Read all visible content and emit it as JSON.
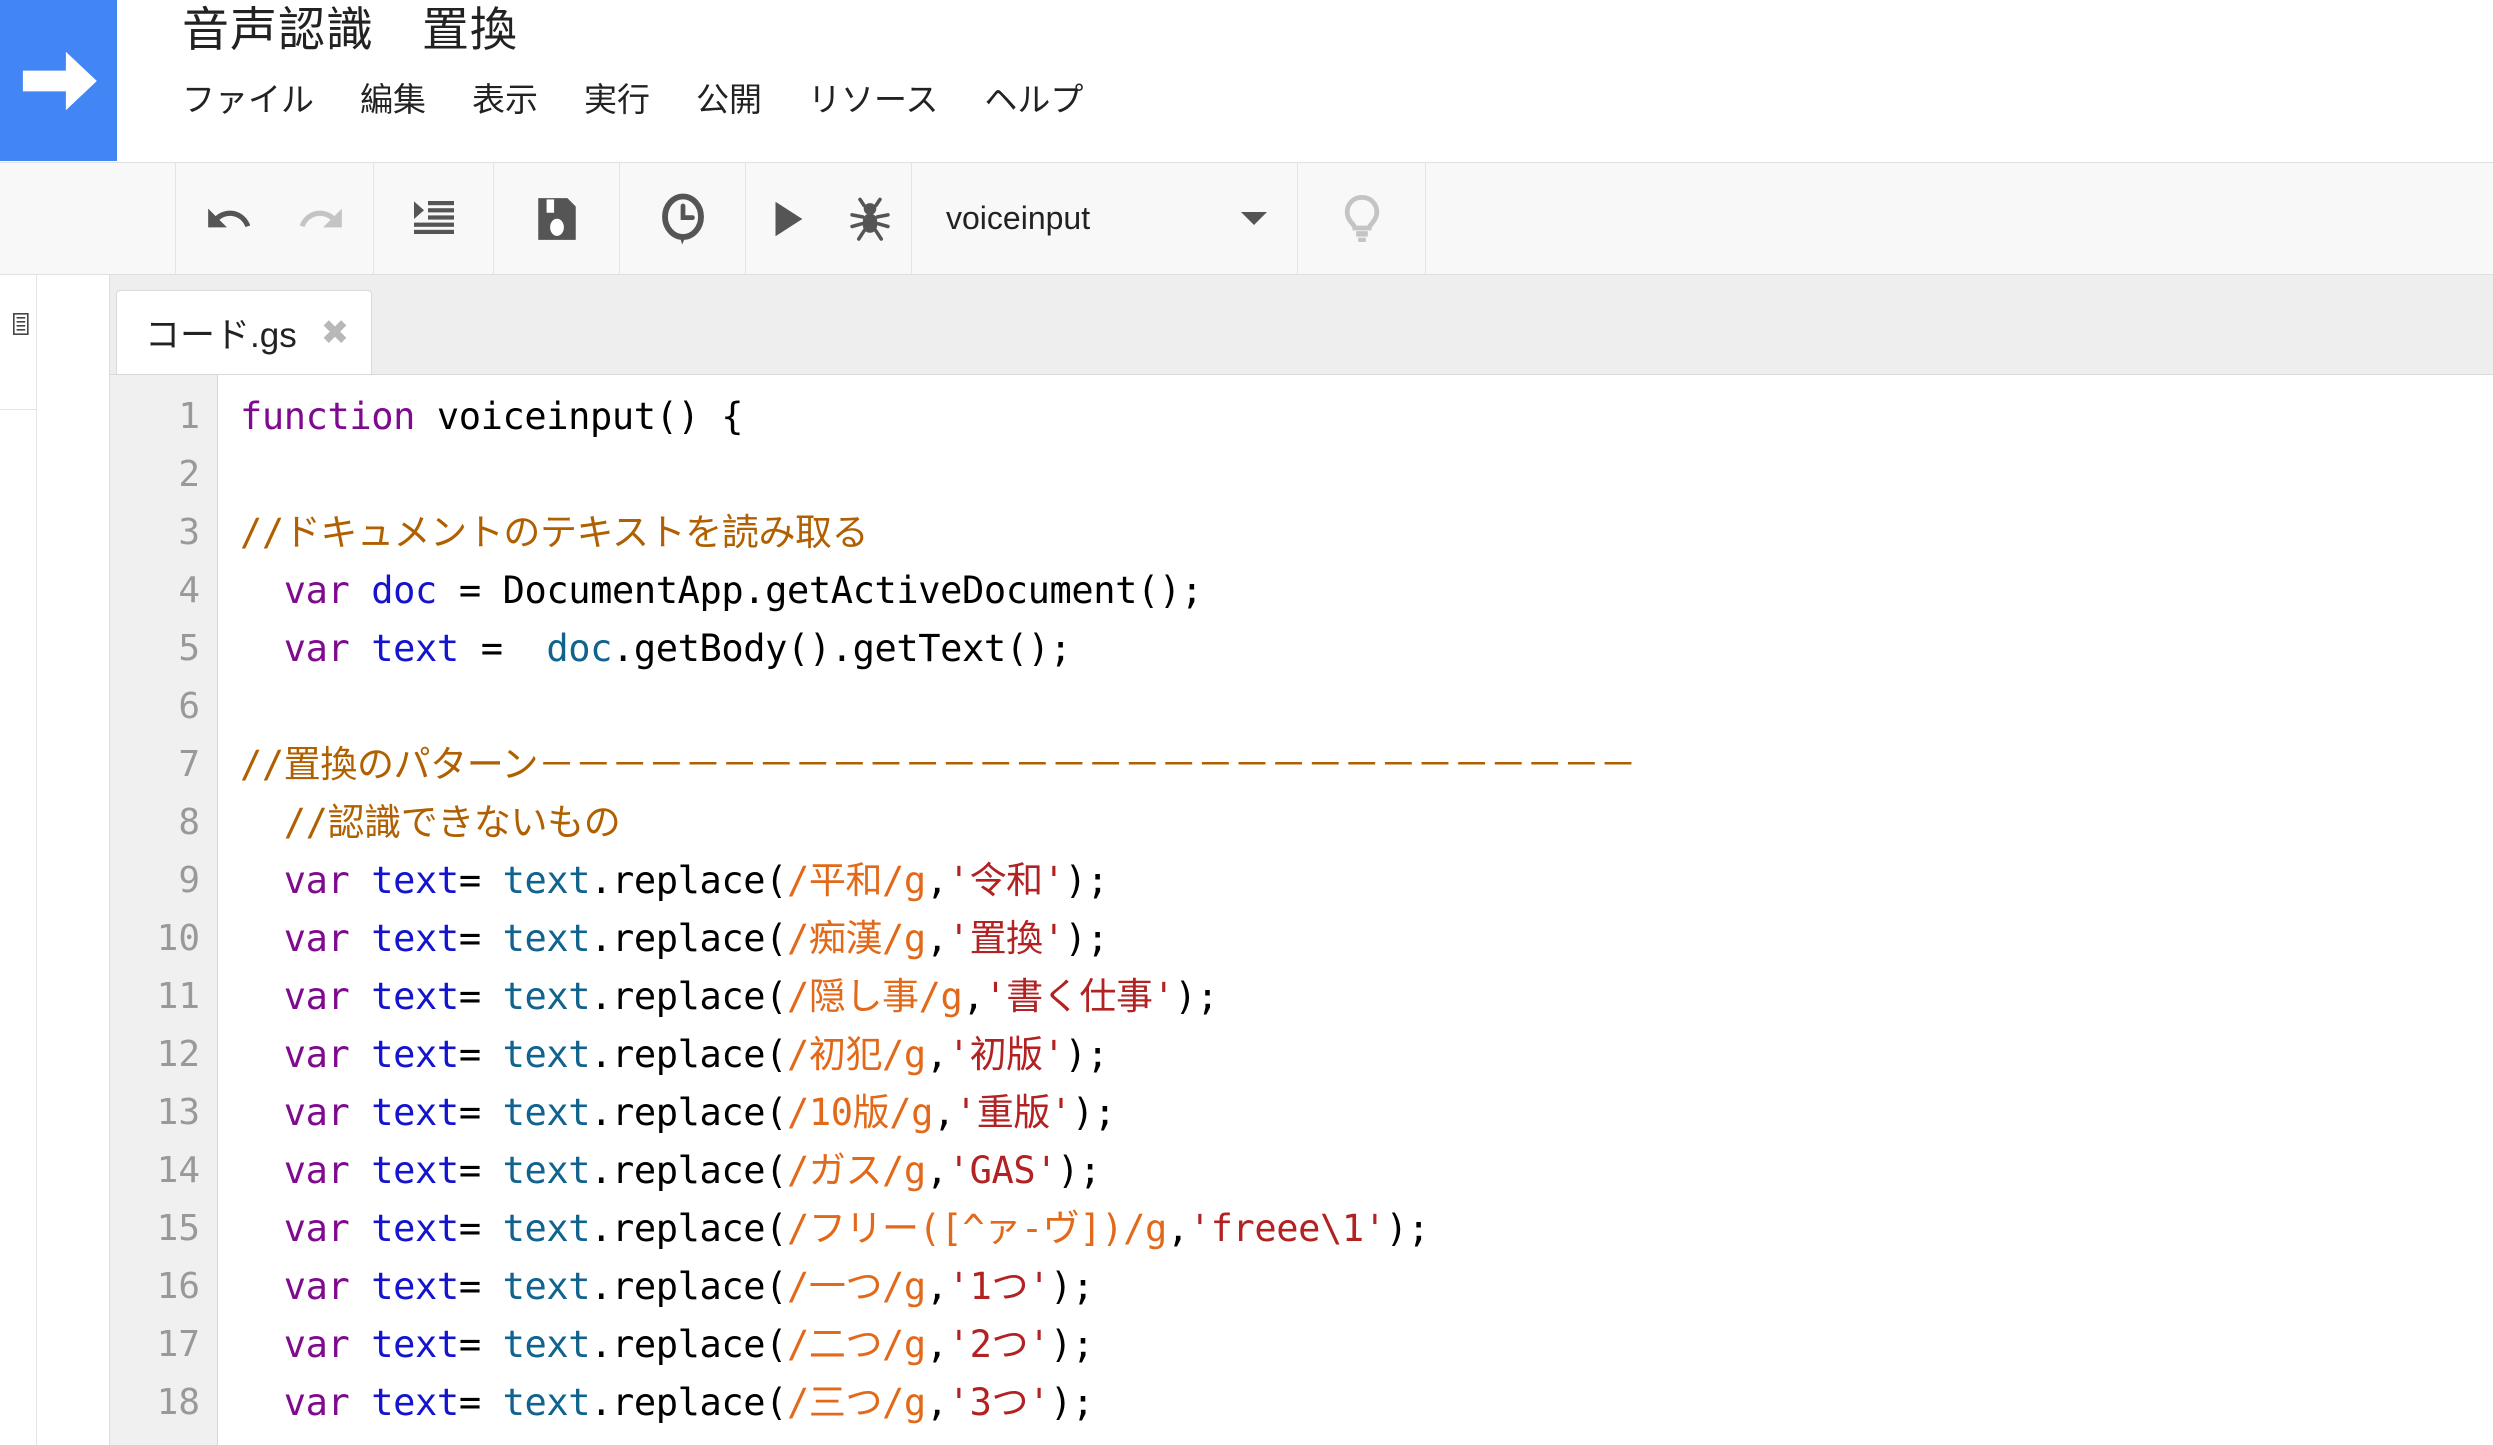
{
  "header": {
    "logo_icon": "arrow-right-icon",
    "doc_title": "音声認識　置換",
    "menu": [
      {
        "label": "ファイル",
        "name": "menu-file"
      },
      {
        "label": "編集",
        "name": "menu-edit"
      },
      {
        "label": "表示",
        "name": "menu-view"
      },
      {
        "label": "実行",
        "name": "menu-run"
      },
      {
        "label": "公開",
        "name": "menu-publish"
      },
      {
        "label": "リソース",
        "name": "menu-resources"
      },
      {
        "label": "ヘルプ",
        "name": "menu-help"
      }
    ]
  },
  "toolbar": {
    "undo_icon": "undo-icon",
    "redo_icon": "redo-icon",
    "indent_icon": "indent-icon",
    "save_icon": "save-icon",
    "history_icon": "clock-history-icon",
    "run_icon": "run-play-icon",
    "debug_icon": "debug-bug-icon",
    "hint_icon": "lightbulb-icon",
    "function_select": {
      "value": "voiceinput",
      "caret_icon": "chevron-down-icon"
    }
  },
  "sidebar": {
    "list_icon": "file-list-icon"
  },
  "editor": {
    "tab": {
      "label": "コード.gs",
      "close_icon": "close-icon",
      "close_glyph": "✖"
    },
    "line_numbers": [
      "1",
      "2",
      "3",
      "4",
      "5",
      "6",
      "7",
      "8",
      "9",
      "10",
      "11",
      "12",
      "13",
      "14",
      "15",
      "16",
      "17",
      "18"
    ],
    "lines": [
      {
        "n": "1",
        "tokens": [
          {
            "t": "function ",
            "c": "kw"
          },
          {
            "t": "voiceinput() {",
            "c": "plain"
          }
        ]
      },
      {
        "n": "2",
        "tokens": [
          {
            "t": "",
            "c": "plain"
          }
        ]
      },
      {
        "n": "3",
        "tokens": [
          {
            "t": "//ドキュメントのテキストを読み取る",
            "c": "comment"
          }
        ]
      },
      {
        "n": "4",
        "tokens": [
          {
            "t": "  ",
            "c": "plain"
          },
          {
            "t": "var",
            "c": "kw"
          },
          {
            "t": " ",
            "c": "plain"
          },
          {
            "t": "doc",
            "c": "var"
          },
          {
            "t": " = DocumentApp.getActiveDocument();",
            "c": "plain"
          }
        ]
      },
      {
        "n": "5",
        "tokens": [
          {
            "t": "  ",
            "c": "plain"
          },
          {
            "t": "var",
            "c": "kw"
          },
          {
            "t": " ",
            "c": "plain"
          },
          {
            "t": "text",
            "c": "var"
          },
          {
            "t": " =  ",
            "c": "plain"
          },
          {
            "t": "doc",
            "c": "obj"
          },
          {
            "t": ".getBody().getText();",
            "c": "plain"
          }
        ]
      },
      {
        "n": "6",
        "tokens": [
          {
            "t": "",
            "c": "plain"
          }
        ]
      },
      {
        "n": "7",
        "tokens": [
          {
            "t": "//置換のパターン－－－－－－－－－－－－－－－－－－－－－－－－－－－－－－",
            "c": "comment"
          }
        ]
      },
      {
        "n": "8",
        "tokens": [
          {
            "t": "  //認識できないもの",
            "c": "comment"
          }
        ]
      },
      {
        "n": "9",
        "tokens": [
          {
            "t": "  ",
            "c": "plain"
          },
          {
            "t": "var",
            "c": "kw"
          },
          {
            "t": " ",
            "c": "plain"
          },
          {
            "t": "text",
            "c": "var"
          },
          {
            "t": "= ",
            "c": "plain"
          },
          {
            "t": "text",
            "c": "obj"
          },
          {
            "t": ".replace(",
            "c": "plain"
          },
          {
            "t": "/平和/g",
            "c": "regex"
          },
          {
            "t": ",",
            "c": "plain"
          },
          {
            "t": "'令和'",
            "c": "str"
          },
          {
            "t": ");",
            "c": "plain"
          }
        ]
      },
      {
        "n": "10",
        "tokens": [
          {
            "t": "  ",
            "c": "plain"
          },
          {
            "t": "var",
            "c": "kw"
          },
          {
            "t": " ",
            "c": "plain"
          },
          {
            "t": "text",
            "c": "var"
          },
          {
            "t": "= ",
            "c": "plain"
          },
          {
            "t": "text",
            "c": "obj"
          },
          {
            "t": ".replace(",
            "c": "plain"
          },
          {
            "t": "/痴漢/g",
            "c": "regex"
          },
          {
            "t": ",",
            "c": "plain"
          },
          {
            "t": "'置換'",
            "c": "str"
          },
          {
            "t": ");",
            "c": "plain"
          }
        ]
      },
      {
        "n": "11",
        "tokens": [
          {
            "t": "  ",
            "c": "plain"
          },
          {
            "t": "var",
            "c": "kw"
          },
          {
            "t": " ",
            "c": "plain"
          },
          {
            "t": "text",
            "c": "var"
          },
          {
            "t": "= ",
            "c": "plain"
          },
          {
            "t": "text",
            "c": "obj"
          },
          {
            "t": ".replace(",
            "c": "plain"
          },
          {
            "t": "/隠し事/g",
            "c": "regex"
          },
          {
            "t": ",",
            "c": "plain"
          },
          {
            "t": "'書く仕事'",
            "c": "str"
          },
          {
            "t": ");",
            "c": "plain"
          }
        ]
      },
      {
        "n": "12",
        "tokens": [
          {
            "t": "  ",
            "c": "plain"
          },
          {
            "t": "var",
            "c": "kw"
          },
          {
            "t": " ",
            "c": "plain"
          },
          {
            "t": "text",
            "c": "var"
          },
          {
            "t": "= ",
            "c": "plain"
          },
          {
            "t": "text",
            "c": "obj"
          },
          {
            "t": ".replace(",
            "c": "plain"
          },
          {
            "t": "/初犯/g",
            "c": "regex"
          },
          {
            "t": ",",
            "c": "plain"
          },
          {
            "t": "'初版'",
            "c": "str"
          },
          {
            "t": ");",
            "c": "plain"
          }
        ]
      },
      {
        "n": "13",
        "tokens": [
          {
            "t": "  ",
            "c": "plain"
          },
          {
            "t": "var",
            "c": "kw"
          },
          {
            "t": " ",
            "c": "plain"
          },
          {
            "t": "text",
            "c": "var"
          },
          {
            "t": "= ",
            "c": "plain"
          },
          {
            "t": "text",
            "c": "obj"
          },
          {
            "t": ".replace(",
            "c": "plain"
          },
          {
            "t": "/10版/g",
            "c": "regex"
          },
          {
            "t": ",",
            "c": "plain"
          },
          {
            "t": "'重版'",
            "c": "str"
          },
          {
            "t": ");",
            "c": "plain"
          }
        ]
      },
      {
        "n": "14",
        "tokens": [
          {
            "t": "  ",
            "c": "plain"
          },
          {
            "t": "var",
            "c": "kw"
          },
          {
            "t": " ",
            "c": "plain"
          },
          {
            "t": "text",
            "c": "var"
          },
          {
            "t": "= ",
            "c": "plain"
          },
          {
            "t": "text",
            "c": "obj"
          },
          {
            "t": ".replace(",
            "c": "plain"
          },
          {
            "t": "/ガス/g",
            "c": "regex"
          },
          {
            "t": ",",
            "c": "plain"
          },
          {
            "t": "'GAS'",
            "c": "str"
          },
          {
            "t": ");",
            "c": "plain"
          }
        ]
      },
      {
        "n": "15",
        "tokens": [
          {
            "t": "  ",
            "c": "plain"
          },
          {
            "t": "var",
            "c": "kw"
          },
          {
            "t": " ",
            "c": "plain"
          },
          {
            "t": "text",
            "c": "var"
          },
          {
            "t": "= ",
            "c": "plain"
          },
          {
            "t": "text",
            "c": "obj"
          },
          {
            "t": ".replace(",
            "c": "plain"
          },
          {
            "t": "/フリー([^ァ-ヴ])/g",
            "c": "regex"
          },
          {
            "t": ",",
            "c": "plain"
          },
          {
            "t": "'freee\\1'",
            "c": "str"
          },
          {
            "t": ");",
            "c": "plain"
          }
        ]
      },
      {
        "n": "16",
        "tokens": [
          {
            "t": "  ",
            "c": "plain"
          },
          {
            "t": "var",
            "c": "kw"
          },
          {
            "t": " ",
            "c": "plain"
          },
          {
            "t": "text",
            "c": "var"
          },
          {
            "t": "= ",
            "c": "plain"
          },
          {
            "t": "text",
            "c": "obj"
          },
          {
            "t": ".replace(",
            "c": "plain"
          },
          {
            "t": "/一つ/g",
            "c": "regex"
          },
          {
            "t": ",",
            "c": "plain"
          },
          {
            "t": "'1つ'",
            "c": "str"
          },
          {
            "t": ");",
            "c": "plain"
          }
        ]
      },
      {
        "n": "17",
        "tokens": [
          {
            "t": "  ",
            "c": "plain"
          },
          {
            "t": "var",
            "c": "kw"
          },
          {
            "t": " ",
            "c": "plain"
          },
          {
            "t": "text",
            "c": "var"
          },
          {
            "t": "= ",
            "c": "plain"
          },
          {
            "t": "text",
            "c": "obj"
          },
          {
            "t": ".replace(",
            "c": "plain"
          },
          {
            "t": "/二つ/g",
            "c": "regex"
          },
          {
            "t": ",",
            "c": "plain"
          },
          {
            "t": "'2つ'",
            "c": "str"
          },
          {
            "t": ");",
            "c": "plain"
          }
        ]
      },
      {
        "n": "18",
        "tokens": [
          {
            "t": "  ",
            "c": "plain"
          },
          {
            "t": "var",
            "c": "kw"
          },
          {
            "t": " ",
            "c": "plain"
          },
          {
            "t": "text",
            "c": "var"
          },
          {
            "t": "= ",
            "c": "plain"
          },
          {
            "t": "text",
            "c": "obj"
          },
          {
            "t": ".replace(",
            "c": "plain"
          },
          {
            "t": "/三つ/g",
            "c": "regex"
          },
          {
            "t": ",",
            "c": "plain"
          },
          {
            "t": "'3つ'",
            "c": "str"
          },
          {
            "t": ");",
            "c": "plain"
          }
        ]
      }
    ]
  },
  "colors": {
    "brand_blue": "#4285f4",
    "keyword_purple": "#7f0a8f",
    "variable_blue": "#1414cf",
    "object_teal": "#11638f",
    "comment_orange": "#b06000",
    "regex_orange": "#e2691a",
    "string_red": "#b22222",
    "toolbar_bg": "#f8f8f8",
    "gutter_bg": "#f0f0f0",
    "tabstrip_bg": "#eeeeee"
  }
}
